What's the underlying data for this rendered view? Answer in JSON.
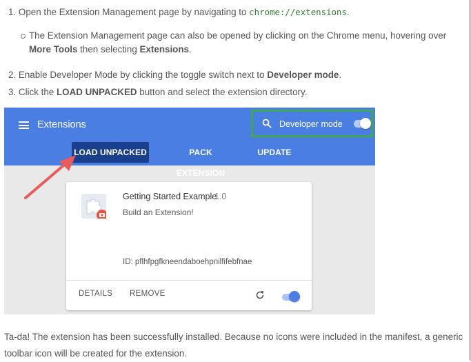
{
  "steps": [
    {
      "num": "1.",
      "text": "Open the Extension Management page by navigating to",
      "code": "chrome://extensions",
      "end": "."
    },
    {
      "num": "2.",
      "text": "Enable Developer Mode by clicking the toggle switch next to",
      "bold": "Developer mode",
      "end": "."
    },
    {
      "num": "3.",
      "text": "Click the",
      "bold": "LOAD UNPACKED",
      "end": " button and select the extension directory."
    }
  ],
  "sub_step": {
    "text1": "The Extension Management page can also be opened by clicking on the Chrome menu, hovering over",
    "bold1": "More Tools",
    "text2": "then selecting",
    "bold2": "Extensions",
    "end": "."
  },
  "screenshot": {
    "title": "Extensions",
    "developer_mode_label": "Developer mode",
    "developer_mode_on": true,
    "tabs": [
      "LOAD UNPACKED",
      "PACK EXTENSION",
      "UPDATE"
    ],
    "card": {
      "name": "Getting Started Example",
      "version": "1.0",
      "description": "Build an Extension!",
      "id_text": "ID: pflhfpgfkneendaboehpnilfifebfnae",
      "details_label": "DETAILS",
      "remove_label": "REMOVE",
      "enabled": true
    },
    "icons": [
      "menu-icon",
      "search-icon",
      "puzzle-icon",
      "reload-icon"
    ],
    "colors": {
      "header": "#4a7ee2",
      "active_tab": "#1a3f8d",
      "highlight_box": "#3fa856",
      "arrow": "#e85c5c"
    }
  },
  "footer": "Ta-da! The extension has been successfully installed. Because no icons were included in the manifest, a generic toolbar icon will be created for the extension."
}
